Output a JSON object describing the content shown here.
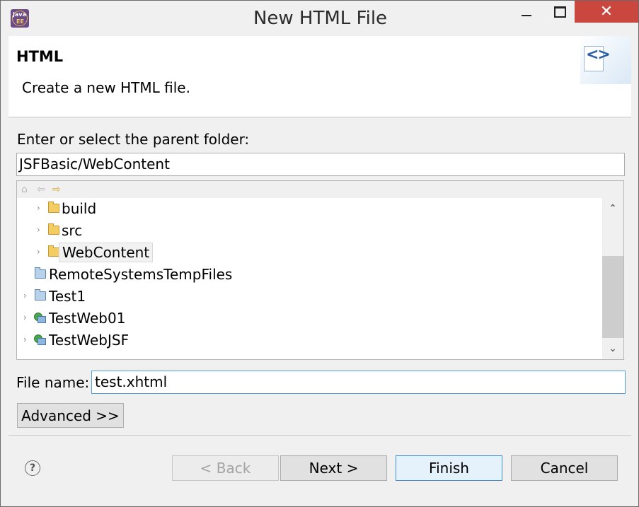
{
  "window": {
    "title": "New HTML File",
    "app_icon": "java-ee-perspective-icon",
    "close_glyph": "✕"
  },
  "header": {
    "title": "HTML",
    "description": "Create a new HTML file.",
    "banner_icon": "html-file-icon"
  },
  "parent_folder": {
    "label": "Enter or select the parent folder:",
    "value": "JSFBasic/WebContent"
  },
  "tree": {
    "toolbar_icons": [
      "home-icon",
      "back-arrow-icon",
      "forward-arrow-icon"
    ],
    "items": [
      {
        "label": "build",
        "icon": "folder-icon",
        "expandable": true,
        "selected": false
      },
      {
        "label": "src",
        "icon": "folder-icon",
        "expandable": true,
        "selected": false
      },
      {
        "label": "WebContent",
        "icon": "folder-icon",
        "expandable": true,
        "selected": true
      },
      {
        "label": "RemoteSystemsTempFiles",
        "icon": "project-folder-icon",
        "expandable": false,
        "selected": false
      },
      {
        "label": "Test1",
        "icon": "project-folder-icon",
        "expandable": true,
        "selected": false
      },
      {
        "label": "TestWeb01",
        "icon": "web-project-icon",
        "expandable": true,
        "selected": false
      },
      {
        "label": "TestWebJSF",
        "icon": "web-project-icon",
        "expandable": true,
        "selected": false
      }
    ],
    "scrollbar": {
      "up_glyph": "⌃",
      "down_glyph": "⌄"
    }
  },
  "file_name": {
    "label": "File name:",
    "value": "test.xhtml"
  },
  "buttons": {
    "advanced": "Advanced >>",
    "help_glyph": "?",
    "back": "< Back",
    "next": "Next >",
    "finish": "Finish",
    "cancel": "Cancel"
  },
  "colors": {
    "close_button": "#c9473f",
    "focus_border": "#3c8ed6",
    "folder": "#f3cd63"
  }
}
